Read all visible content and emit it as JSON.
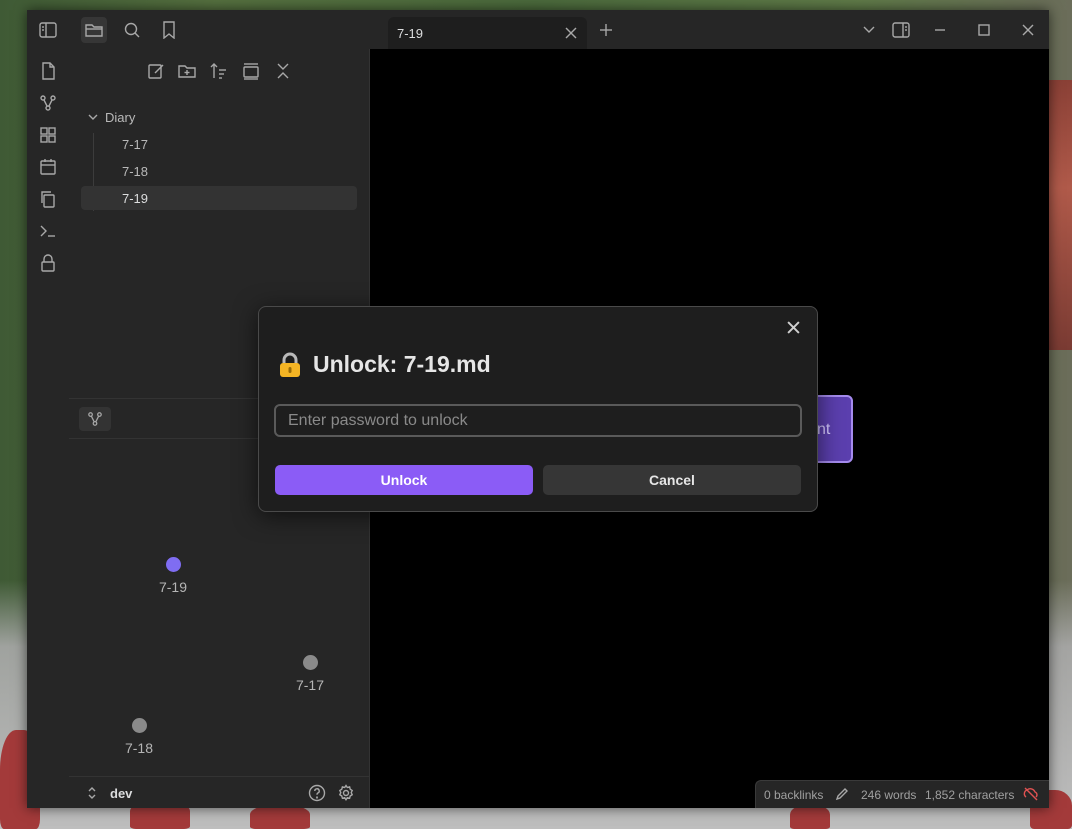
{
  "tab": {
    "title": "7-19"
  },
  "file_tree": {
    "folder": "Diary",
    "items": [
      {
        "label": "7-17"
      },
      {
        "label": "7-18"
      },
      {
        "label": "7-19"
      }
    ],
    "selected": "7-19"
  },
  "graph": {
    "nodes": [
      {
        "label": "7-19",
        "color": "#7f6df2"
      },
      {
        "label": "7-17",
        "color": "#8a8a8a"
      },
      {
        "label": "7-18",
        "color": "#8a8a8a"
      }
    ]
  },
  "vault": {
    "name": "dev"
  },
  "background_button": {
    "label_fragment": "nt"
  },
  "modal": {
    "title": "Unlock: 7-19.md",
    "password_placeholder": "Enter password to unlock",
    "password_value": "",
    "unlock_label": "Unlock",
    "cancel_label": "Cancel"
  },
  "statusbar": {
    "backlinks": "0 backlinks",
    "words": "246 words",
    "characters": "1,852 characters"
  },
  "colors": {
    "accent": "#8b5cf6",
    "background": "#1e1e1e",
    "panel": "#262626",
    "sync_error": "#e05252"
  },
  "icons": {
    "ribbon": [
      "file-icon",
      "graph-icon",
      "canvas-icon",
      "calendar-icon",
      "copy-icon",
      "terminal-icon",
      "lock-icon"
    ],
    "titlebar": [
      "sidebar-toggle-icon",
      "folder-icon",
      "search-icon",
      "bookmark-icon",
      "plus-icon",
      "chevron-down-icon",
      "right-sidebar-icon",
      "minimize-icon",
      "maximize-icon",
      "close-icon"
    ],
    "tree_toolbar": [
      "new-note-icon",
      "new-folder-icon",
      "sort-icon",
      "auto-reveal-icon",
      "collapse-all-icon"
    ]
  }
}
